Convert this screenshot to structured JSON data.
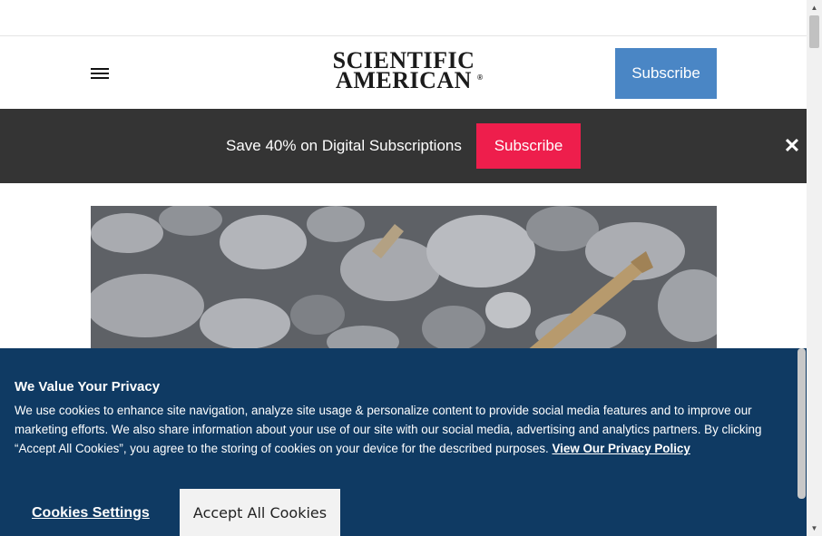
{
  "header": {
    "logo_line1": "SCIENTIFIC",
    "logo_line2": "AMERICAN",
    "logo_mark": "®",
    "subscribe_label": "Subscribe",
    "menu_icon": "hamburger-menu-icon"
  },
  "promo": {
    "text": "Save 40% on Digital Subscriptions",
    "button_label": "Subscribe",
    "close_glyph": "✕"
  },
  "cookie_banner": {
    "title": "We Value Your Privacy",
    "body": "We use cookies to enhance site navigation, analyze site usage & personalize content to provide social media features and to improve our marketing efforts. We also share information about your use of our site with our social media, advertising and analytics partners. By clicking “Accept All Cookies”, you agree to the storing of cookies on your device for the described purposes. ",
    "privacy_link": "View Our Privacy Policy",
    "settings_label": "Cookies Settings",
    "accept_label": "Accept All Cookies"
  },
  "colors": {
    "subscribe_blue": "#4a86c5",
    "promo_bg": "#343434",
    "promo_button": "#ee1e4c",
    "cookie_bg": "#0f3a63"
  },
  "scrollbar": {
    "up_glyph": "▲",
    "down_glyph": "▼"
  }
}
